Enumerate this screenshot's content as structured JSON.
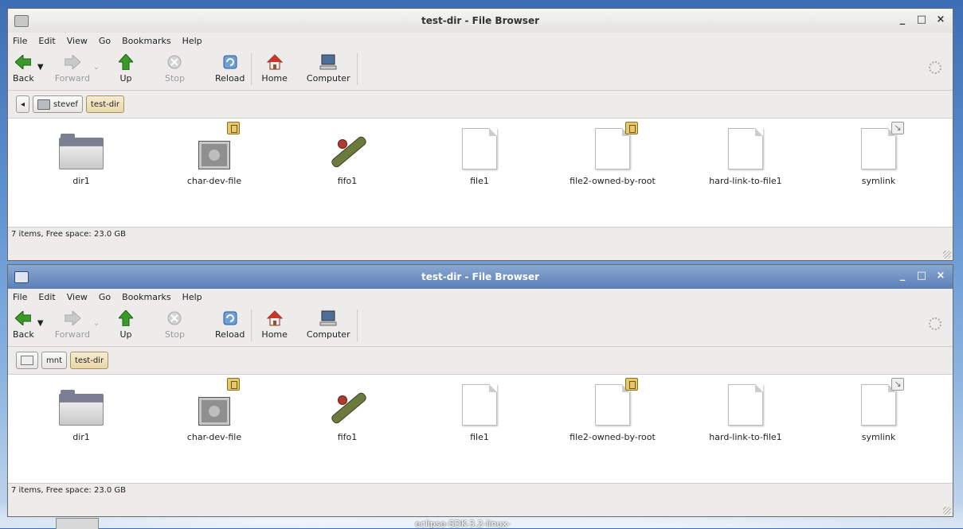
{
  "desktop": {
    "label": "eclipse-SDK-3.2-linux-"
  },
  "windows": [
    {
      "title": "test-dir - File Browser",
      "controls": {
        "minimize": "_",
        "maximize": "□",
        "close": "×"
      },
      "menu": [
        "File",
        "Edit",
        "View",
        "Go",
        "Bookmarks",
        "Help"
      ],
      "toolbar": {
        "back": "Back",
        "forward": "Forward",
        "up": "Up",
        "stop": "Stop",
        "reload": "Reload",
        "home": "Home",
        "computer": "Computer"
      },
      "path": {
        "parent": "stevef",
        "current": "test-dir"
      },
      "items": [
        {
          "name": "dir1",
          "icon": "folder-icon"
        },
        {
          "name": "char-dev-file",
          "icon": "chip-icon",
          "emblem": "lock"
        },
        {
          "name": "fifo1",
          "icon": "pipe-icon"
        },
        {
          "name": "file1",
          "icon": "file-icon"
        },
        {
          "name": "file2-owned-by-root",
          "icon": "file-icon",
          "emblem": "lock"
        },
        {
          "name": "hard-link-to-file1",
          "icon": "file-icon"
        },
        {
          "name": "symlink",
          "icon": "file-icon",
          "emblem": "link"
        }
      ],
      "status": "7 items, Free space: 23.0 GB"
    },
    {
      "title": "test-dir - File Browser",
      "controls": {
        "minimize": "_",
        "maximize": "□",
        "close": "×"
      },
      "menu": [
        "File",
        "Edit",
        "View",
        "Go",
        "Bookmarks",
        "Help"
      ],
      "toolbar": {
        "back": "Back",
        "forward": "Forward",
        "up": "Up",
        "stop": "Stop",
        "reload": "Reload",
        "home": "Home",
        "computer": "Computer"
      },
      "path": {
        "parent": "mnt",
        "current": "test-dir"
      },
      "items": [
        {
          "name": "dir1",
          "icon": "folder-icon"
        },
        {
          "name": "char-dev-file",
          "icon": "chip-icon",
          "emblem": "lock"
        },
        {
          "name": "fifo1",
          "icon": "pipe-icon"
        },
        {
          "name": "file1",
          "icon": "file-icon"
        },
        {
          "name": "file2-owned-by-root",
          "icon": "file-icon",
          "emblem": "lock"
        },
        {
          "name": "hard-link-to-file1",
          "icon": "file-icon"
        },
        {
          "name": "symlink",
          "icon": "file-icon",
          "emblem": "link"
        }
      ],
      "status": "7 items, Free space: 23.0 GB"
    }
  ]
}
